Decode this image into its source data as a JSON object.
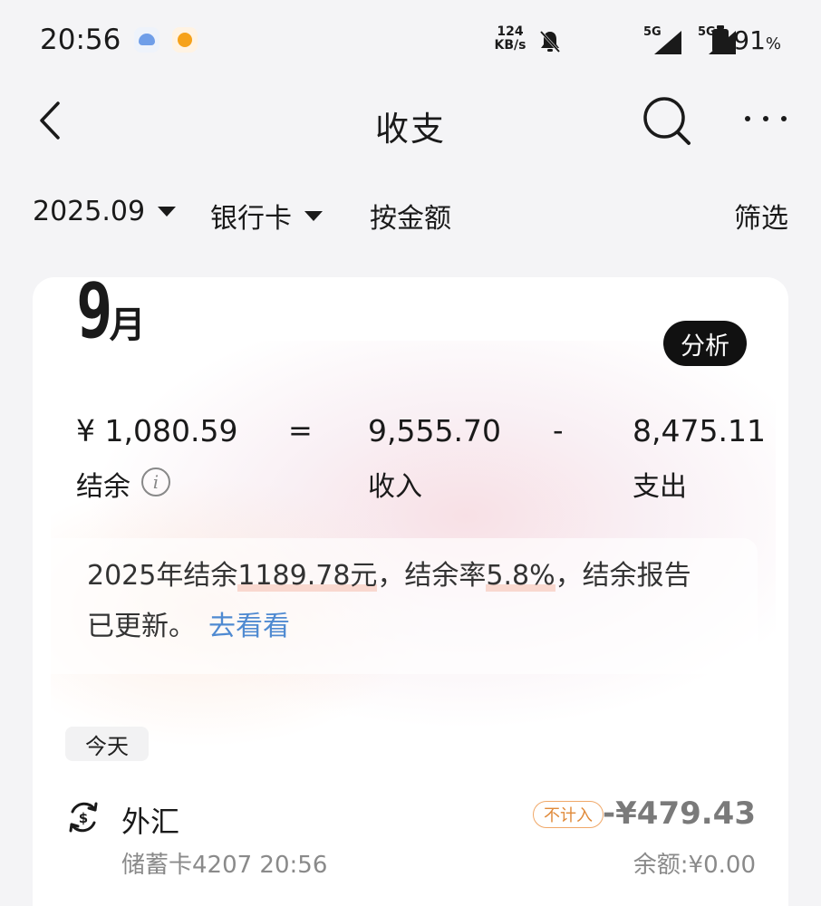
{
  "status_bar": {
    "time": "20:56",
    "network_speed_value": "124",
    "network_speed_unit": "KB/s",
    "sim1_label": "5G",
    "sim2_label": "5G",
    "battery_value": "91",
    "battery_unit": "%"
  },
  "header": {
    "title": "收支",
    "back_icon": "chevron-left-icon",
    "search_icon": "search-icon",
    "more_icon": "more-horizontal-icon"
  },
  "filters": {
    "month": "2025.09",
    "account": "银行卡",
    "sort": "按金额",
    "filter": "筛选"
  },
  "summary": {
    "month_number": "9",
    "month_unit": "月",
    "analysis_button": "分析",
    "balance_value": "¥ 1,080.59",
    "balance_label": "结余",
    "equals": "=",
    "income_value": "9,555.70",
    "income_label": "收入",
    "minus": "-",
    "expense_value": "8,475.11",
    "expense_label": "支出",
    "info_icon": "info-icon"
  },
  "report": {
    "prefix": "2025年结余",
    "amount": "1189.78元",
    "mid": "，结余率",
    "rate": "5.8%",
    "suffix": "，结余报告已更新。",
    "link": "去看看"
  },
  "transactions": {
    "group_label": "今天",
    "items": [
      {
        "icon": "currency-exchange-icon",
        "name": "外汇",
        "meta": "储蓄卡4207 20:56",
        "tag": "不计入",
        "amount": "-¥479.43",
        "balance": "余额:¥0.00"
      }
    ]
  },
  "colors": {
    "accent_link": "#4f8ad1",
    "tag_orange": "#e08a3a",
    "highlight": "#f9d8cf",
    "analysis_bg": "#111111"
  }
}
